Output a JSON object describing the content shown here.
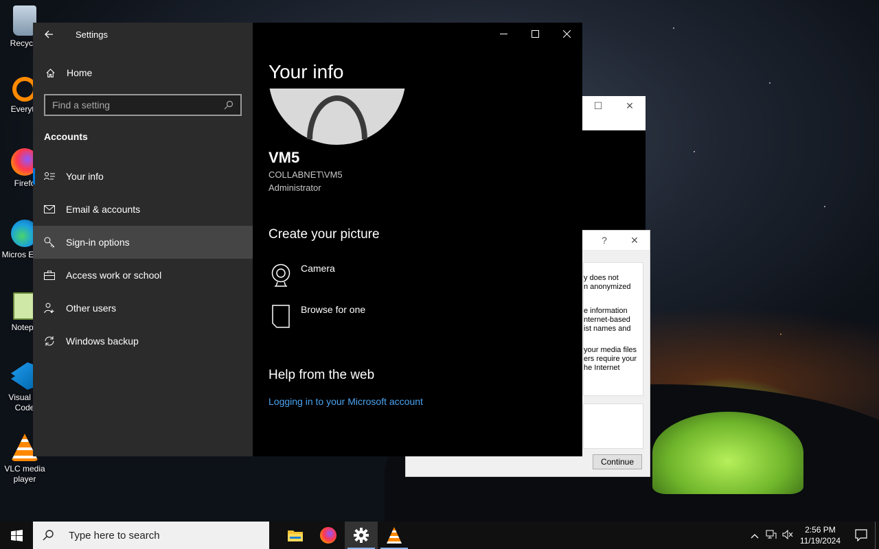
{
  "desktop": {
    "icons": [
      {
        "label": "Recycle",
        "icon": "recycle-bin-icon"
      },
      {
        "label": "Everyth",
        "icon": "everything-search-icon"
      },
      {
        "label": "Firefo",
        "icon": "firefox-icon"
      },
      {
        "label": "Micros Edge",
        "icon": "edge-icon"
      },
      {
        "label": "Notepa",
        "icon": "notepad-icon"
      },
      {
        "label": "Visual St Code",
        "icon": "vscode-icon"
      },
      {
        "label": "VLC media player",
        "icon": "vlc-icon"
      }
    ]
  },
  "background_dialog": {
    "help_glyph": "?",
    "text_lines": [
      "y does not",
      "n anonymized",
      "e information",
      "nternet-based",
      "ist names and",
      "your media files",
      "ers require your",
      "he Internet"
    ],
    "continue_label": "Continue"
  },
  "settings": {
    "app_title": "Settings",
    "home_label": "Home",
    "search_placeholder": "Find a setting",
    "section_heading": "Accounts",
    "nav_items": [
      {
        "label": "Your info",
        "icon": "person-list-icon"
      },
      {
        "label": "Email & accounts",
        "icon": "mail-icon"
      },
      {
        "label": "Sign-in options",
        "icon": "key-icon"
      },
      {
        "label": "Access work or school",
        "icon": "briefcase-icon"
      },
      {
        "label": "Other users",
        "icon": "add-person-icon"
      },
      {
        "label": "Windows backup",
        "icon": "sync-icon"
      }
    ],
    "page_title": "Your info",
    "user": {
      "name": "VM5",
      "domain": "COLLABNET\\VM5",
      "role": "Administrator"
    },
    "create_picture_heading": "Create your picture",
    "actions": [
      {
        "label": "Camera",
        "icon": "camera-icon"
      },
      {
        "label": "Browse for one",
        "icon": "file-icon"
      }
    ],
    "help_heading": "Help from the web",
    "help_link": "Logging in to your Microsoft account"
  },
  "taskbar": {
    "search_placeholder": "Type here to search",
    "apps": [
      "file-explorer-icon",
      "firefox-icon",
      "settings-gear-icon",
      "vlc-icon"
    ],
    "time": "2:56 PM",
    "date": "11/19/2024"
  },
  "colors": {
    "accent": "#0078d7",
    "link": "#4aa3f0",
    "sidebar_bg": "#2b2b2b",
    "main_bg": "#000000"
  }
}
